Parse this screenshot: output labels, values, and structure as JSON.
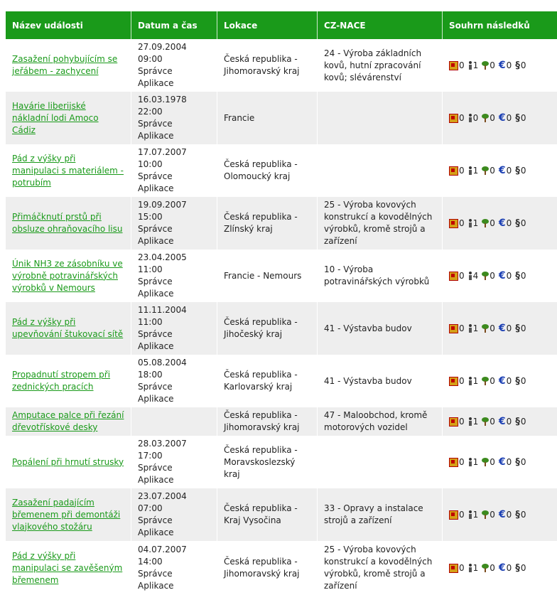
{
  "headers": [
    "Název události",
    "Datum a čas",
    "Lokace",
    "CZ-NACE",
    "Souhrn následků"
  ],
  "rows": [
    {
      "name": "Zasažení pohybujícím se jeřábem - zachycení",
      "date": "27.09.2004 09:00",
      "user": "Správce Aplikace",
      "location": "Česká republika - Jihomoravský kraj",
      "nace": "24 - Výroba základních kovů, hutní zpracování kovů; slévárenství",
      "money": "0",
      "people": "1",
      "env": "0",
      "euro": "0",
      "law": "0"
    },
    {
      "name": "Havárie liberijské nákladní lodi Amoco Cádiz",
      "date": "16.03.1978 22:00",
      "user": "Správce Aplikace",
      "location": "Francie",
      "nace": "",
      "money": "0",
      "people": "0",
      "env": "0",
      "euro": "0",
      "law": "0"
    },
    {
      "name": "Pád z výšky při manipulaci s materiálem - potrubím",
      "date": "17.07.2007 10:00",
      "user": "Správce Aplikace",
      "location": "Česká republika - Olomoucký kraj",
      "nace": "",
      "money": "0",
      "people": "1",
      "env": "0",
      "euro": "0",
      "law": "0"
    },
    {
      "name": "Přimáčknutí prstů při obsluze ohraňovacího lisu",
      "date": "19.09.2007 15:00",
      "user": "Správce Aplikace",
      "location": "Česká republika - Zlínský kraj",
      "nace": "25 - Výroba kovových konstrukcí a kovodělných výrobků, kromě strojů a zařízení",
      "money": "0",
      "people": "1",
      "env": "0",
      "euro": "0",
      "law": "0"
    },
    {
      "name": "Únik NH3 ze zásobníku ve výrobně potravinářských výrobků v Nemours",
      "date": "23.04.2005 11:00",
      "user": "Správce Aplikace",
      "location": "Francie - Nemours",
      "nace": "10 - Výroba potravinářských výrobků",
      "money": "0",
      "people": "4",
      "env": "0",
      "euro": "0",
      "law": "0"
    },
    {
      "name": "Pád z výšky při upevňování štukovací sítě",
      "date": "11.11.2004 11:00",
      "user": "Správce Aplikace",
      "location": "Česká republika - Jihočeský kraj",
      "nace": "41 - Výstavba budov",
      "money": "0",
      "people": "1",
      "env": "0",
      "euro": "0",
      "law": "0"
    },
    {
      "name": "Propadnutí stropem při zednických pracích",
      "date": "05.08.2004 18:00",
      "user": "Správce Aplikace",
      "location": "Česká republika - Karlovarský kraj",
      "nace": "41 - Výstavba budov",
      "money": "0",
      "people": "1",
      "env": "0",
      "euro": "0",
      "law": "0"
    },
    {
      "name": "Amputace palce při řezání dřevotřískové desky",
      "date": "",
      "user": "",
      "location": "Česká republika - Jihomoravský kraj",
      "nace": "47 - Maloobchod, kromě motorových vozidel",
      "money": "0",
      "people": "1",
      "env": "0",
      "euro": "0",
      "law": "0"
    },
    {
      "name": "Popálení při hrnutí strusky",
      "date": "28.03.2007 17:00",
      "user": "Správce Aplikace",
      "location": "Česká republika - Moravskoslezský kraj",
      "nace": "",
      "money": "0",
      "people": "1",
      "env": "0",
      "euro": "0",
      "law": "0"
    },
    {
      "name": "Zasažení padajícím břemenem při demontáži vlajkového stožáru",
      "date": "23.07.2004 07:00",
      "user": "Správce Aplikace",
      "location": "Česká republika - Kraj Vysočina",
      "nace": "33 - Opravy a instalace strojů a zařízení",
      "money": "0",
      "people": "1",
      "env": "0",
      "euro": "0",
      "law": "0"
    },
    {
      "name": "Pád z výšky při manipulaci se zavěšeným břemenem",
      "date": "04.07.2007 14:00",
      "user": "Správce Aplikace",
      "location": "Česká republika - Jihomoravský kraj",
      "nace": "25 - Výroba kovových konstrukcí a kovodělných výrobků, kromě strojů a zařízení",
      "money": "0",
      "people": "1",
      "env": "0",
      "euro": "0",
      "law": "0"
    }
  ],
  "icons": {
    "money": "money-damage-icon",
    "people": "injured-people-icon",
    "env": "environment-damage-icon",
    "euro": "euro-icon",
    "law": "paragraph-icon"
  },
  "colors": {
    "header_bg": "#1a9a1a",
    "link": "#1a9a1a",
    "row_alt": "#eeeeee"
  }
}
